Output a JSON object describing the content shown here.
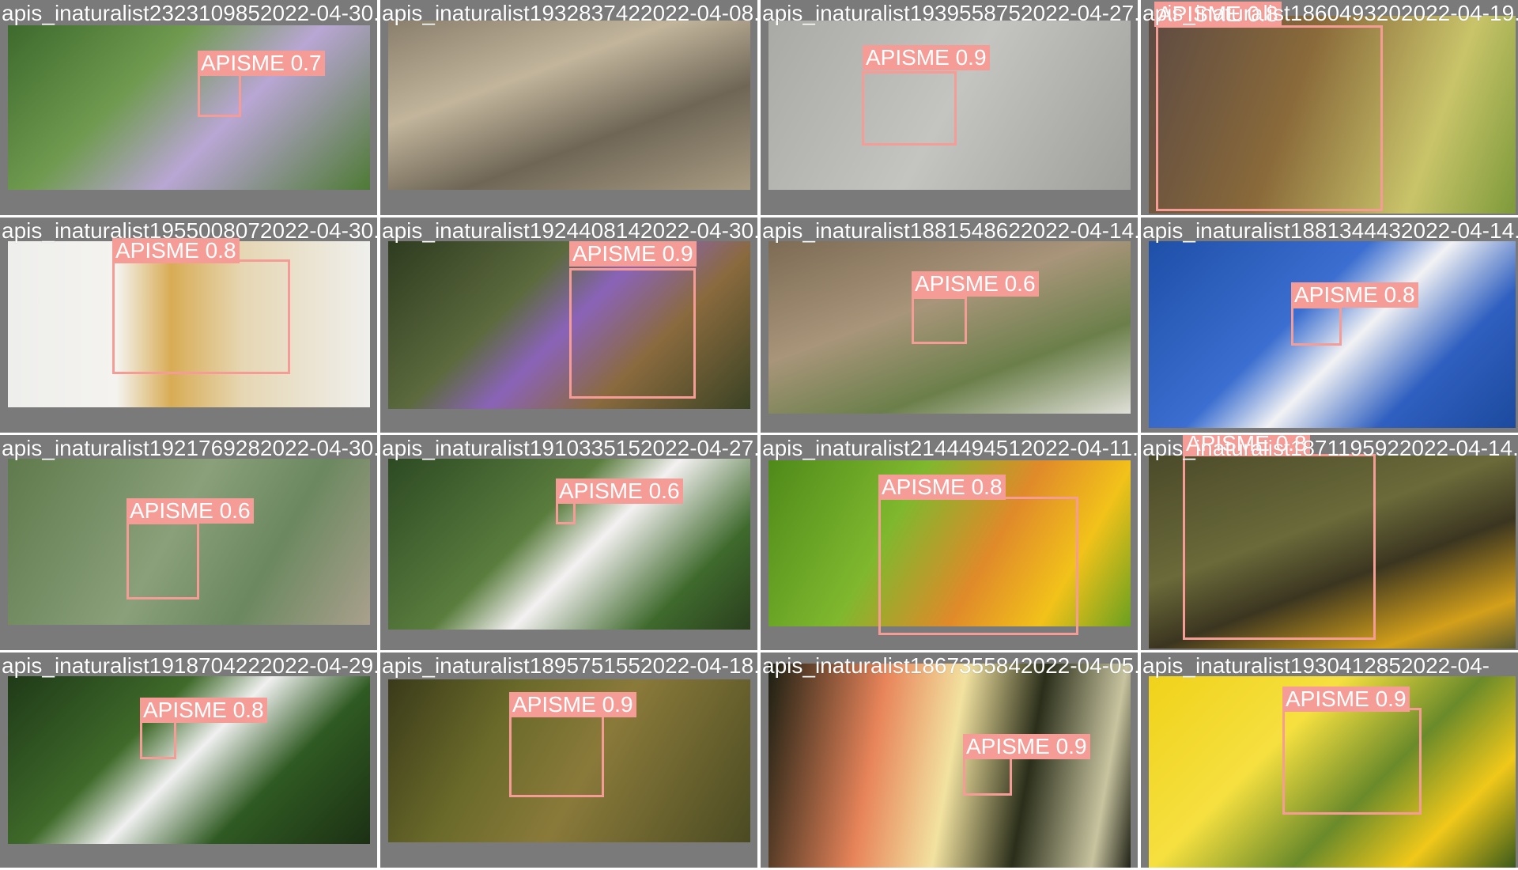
{
  "grid_title": "",
  "tiles": [
    {
      "filename": "apis_inaturalist2323109852022-04-30.jpg",
      "label": "APISME 0.7",
      "bg": "linear-gradient(135deg,#3d6a2d 0%,#6f9a4f 35%,#b9a6d4 60%,#4e7a35 100%)"
    },
    {
      "filename": "apis_inaturalist1932837422022-04-08.jpg",
      "label": "",
      "bg": "linear-gradient(160deg,#8a7f6c 0%,#c2b59c 35%,#6f6656 65%,#a89b82 100%)"
    },
    {
      "filename": "apis_inaturalist1939558752022-04-27.jpg",
      "label": "APISME 0.9",
      "bg": "linear-gradient(120deg,#a9a9a5 0%,#c4c4c0 50%,#9e9e9a 100%)"
    },
    {
      "filename": "apis_inaturalist1860493202022-04-19.jpg",
      "label": "APISME 0.8",
      "bg": "linear-gradient(110deg,#5d4a42 0%,#8a6a3a 40%,#c9c46a 75%,#7d9a3a 100%)"
    },
    {
      "filename": "apis_inaturalist1955008072022-04-30.jpg",
      "label": "APISME 0.8",
      "bg": "linear-gradient(90deg,#eeeeec 0%,#f4f3ef 30%,#d8ac55 45%,#e6d7b4 65%,#efefec 100%)"
    },
    {
      "filename": "apis_inaturalist1924408142022-04-30.jpg",
      "label": "APISME 0.9",
      "bg": "linear-gradient(135deg,#2e3b1f 0%,#5c6a3e 35%,#8a63b8 50%,#8a6a3e 70%,#3a4224 100%)"
    },
    {
      "filename": "apis_inaturalist1881548622022-04-14.jpg",
      "label": "APISME 0.6",
      "bg": "linear-gradient(160deg,#7d6b54 0%,#a8957a 40%,#6b7f4a 70%,#e0e0d8 100%)"
    },
    {
      "filename": "apis_inaturalist1881344432022-04-14.jpg",
      "label": "APISME 0.8",
      "bg": "linear-gradient(135deg,#1e4fa8 0%,#3b6ed0 40%,#f2f2f4 55%,#2f5fc0 75%,#1c4a9e 100%)"
    },
    {
      "filename": "apis_inaturalist1921769282022-04-30.jpg",
      "label": "APISME 0.6",
      "bg": "linear-gradient(120deg,#5f7a4c 0%,#8aa07a 45%,#6b8860 70%,#a9a08c 100%)"
    },
    {
      "filename": "apis_inaturalist1910335152022-04-27.jpg",
      "label": "APISME 0.6",
      "bg": "linear-gradient(135deg,#2d4a23 0%,#5a7d3e 40%,#f4f1f2 55%,#3f6a2d 80%,#2a3f1e 100%)"
    },
    {
      "filename": "apis_inaturalist2144494512022-04-11.jpg",
      "label": "APISME 0.8",
      "bg": "linear-gradient(120deg,#4f8a1a 0%,#7fb82e 35%,#e08a2a 60%,#f2c21a 80%,#6aa020 100%)"
    },
    {
      "filename": "apis_inaturalist1871195922022-04-14.jpg",
      "label": "APISME 0.8",
      "bg": "linear-gradient(160deg,#4b4a2a 0%,#6a6a3a 40%,#3b3520 60%,#d4a01a 85%,#5a5a30 100%)"
    },
    {
      "filename": "apis_inaturalist1918704222022-04-29.jpg",
      "label": "APISME 0.8",
      "bg": "linear-gradient(135deg,#1f3a18 0%,#3f6a2a 35%,#f0f0f0 50%,#2f5a22 70%,#1c3014 100%)"
    },
    {
      "filename": "apis_inaturalist1895751552022-04-18.jpg",
      "label": "APISME 0.9",
      "bg": "linear-gradient(120deg,#3a3a1a 0%,#6a6a2a 30%,#8a7a3a 55%,#4a4a22 100%)"
    },
    {
      "filename": "apis_inaturalist1867355842022-04-05.jpg",
      "label": "APISME 0.9",
      "bg": "linear-gradient(100deg,#1c1f12 0%,#e8845a 30%,#f2e2a0 50%,#2a2e1a 70%,#c8c4a0 90%,#1e2014 100%)"
    },
    {
      "filename": "apis_inaturalist1930412852022-04-",
      "label": "APISME 0.9",
      "bg": "linear-gradient(135deg,#f0d21a 0%,#f6e040 35%,#6a8a2a 60%,#f0c81a 80%,#3a5a1a 100%)"
    }
  ]
}
